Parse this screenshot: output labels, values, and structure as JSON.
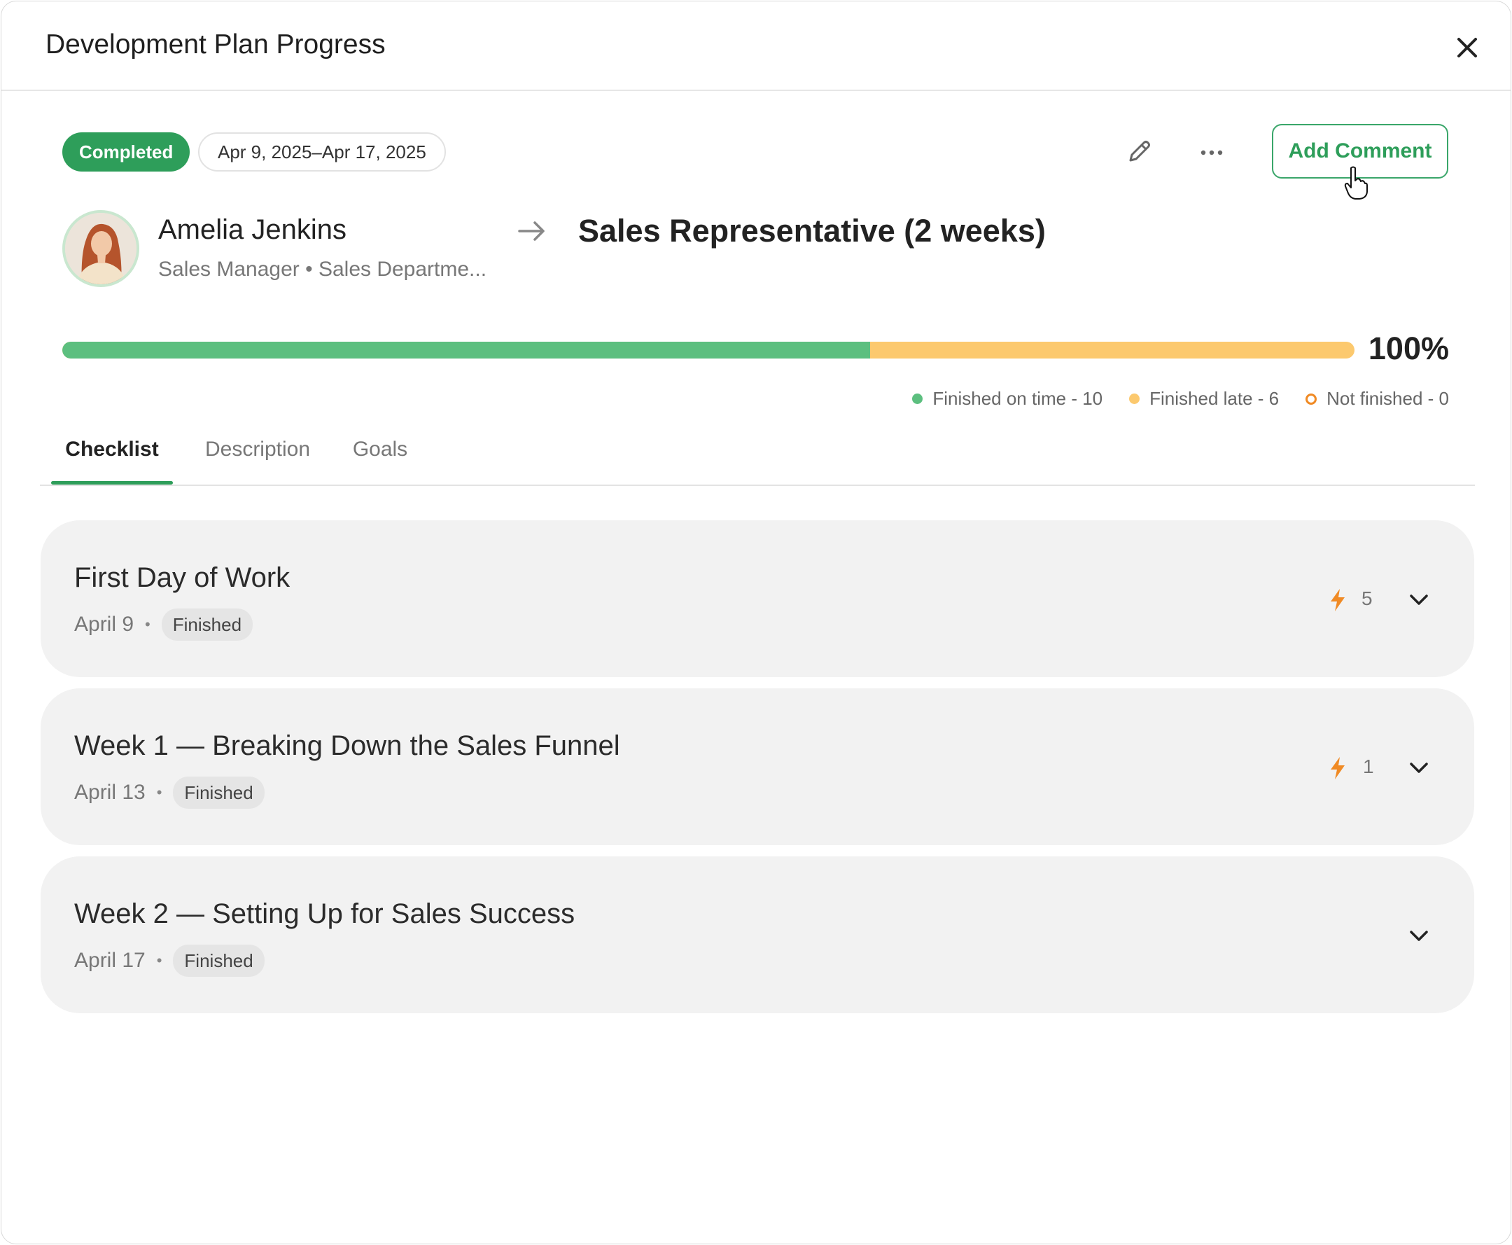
{
  "header": {
    "title": "Development Plan Progress"
  },
  "status": {
    "label": "Completed",
    "color": "#2e9e5a"
  },
  "date_range": "Apr 9, 2025–Apr 17, 2025",
  "actions": {
    "add_comment": "Add Comment"
  },
  "person": {
    "name": "Amelia Jenkins",
    "subtitle": "Sales Manager • Sales Departme..."
  },
  "plan": {
    "title": "Sales Representative (2 weeks)"
  },
  "progress": {
    "percent_label": "100%",
    "on_time_fraction": 0.625,
    "legend": [
      {
        "label": "Finished on time - 10",
        "color": "#5cbf7f"
      },
      {
        "label": "Finished late - 6",
        "color": "#fcc96e"
      },
      {
        "label": "Not finished - 0",
        "color": "#f08a24"
      }
    ]
  },
  "tabs": [
    {
      "label": "Checklist",
      "active": true
    },
    {
      "label": "Description",
      "active": false
    },
    {
      "label": "Goals",
      "active": false
    }
  ],
  "checklist": [
    {
      "title": "First Day of Work",
      "date": "April 9",
      "status": "Finished",
      "count": "5"
    },
    {
      "title": "Week 1 — Breaking Down the Sales Funnel",
      "date": "April 13",
      "status": "Finished",
      "count": "1"
    },
    {
      "title": "Week 2 — Setting Up for Sales Success",
      "date": "April 17",
      "status": "Finished",
      "count": ""
    }
  ],
  "icons": {
    "close": "close-icon",
    "edit": "pencil-icon",
    "more": "more-horizontal-icon",
    "arrow": "arrow-right-icon",
    "bolt": "lightning-icon",
    "chevron": "chevron-down-icon"
  }
}
